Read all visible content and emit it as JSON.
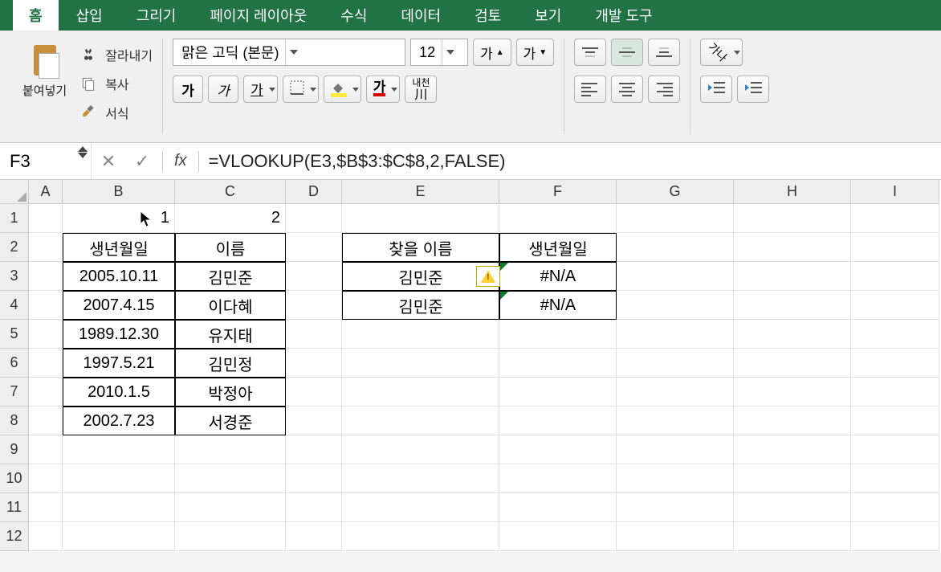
{
  "tabs": {
    "home": "홈",
    "insert": "삽입",
    "draw": "그리기",
    "pagelayout": "페이지 레이아웃",
    "formula": "수식",
    "data": "데이터",
    "review": "검토",
    "view": "보기",
    "dev": "개발 도구"
  },
  "clipboard": {
    "paste": "붙여넣기",
    "cut": "잘라내기",
    "copy": "복사",
    "format": "서식"
  },
  "font": {
    "name": "맑은 고딕 (본문)",
    "size": "12",
    "bold": "가",
    "italic": "가",
    "underline": "가",
    "grow": "가",
    "shrink": "가",
    "fontcolor": "가",
    "hanja": "내천"
  },
  "formula_bar": {
    "cell": "F3",
    "fx": "fx",
    "formula": "=VLOOKUP(E3,$B$3:$C$8,2,FALSE)"
  },
  "columns": [
    "A",
    "B",
    "C",
    "D",
    "E",
    "F",
    "G",
    "H",
    "I"
  ],
  "rows": [
    "1",
    "2",
    "3",
    "4",
    "5",
    "6",
    "7",
    "8",
    "9",
    "10",
    "11",
    "12"
  ],
  "cells": {
    "B1": "1",
    "C1": "2",
    "B2": "생년월일",
    "C2": "이름",
    "E2": "찾을 이름",
    "F2": "생년월일",
    "B3": "2005.10.11",
    "C3": "김민준",
    "B4": "2007.4.15",
    "C4": "이다혜",
    "B5": "1989.12.30",
    "C5": "유지태",
    "B6": "1997.5.21",
    "C6": "김민정",
    "B7": "2010.1.5",
    "C7": "박정아",
    "B8": "2002.7.23",
    "C8": "서경준",
    "E3": "김민준",
    "E4": "김민준",
    "F3": "#N/A",
    "F4": "#N/A"
  },
  "wrap_label": "가나"
}
